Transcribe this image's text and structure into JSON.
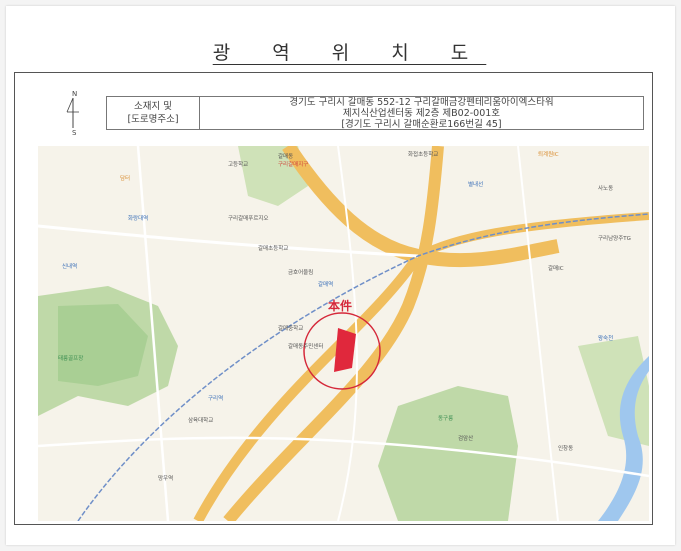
{
  "title": "광 역 위 치 도",
  "compass": {
    "north": "N",
    "south": "S"
  },
  "info": {
    "label_line1": "소재지 및",
    "label_line2": "[도로명주소]",
    "address_line1": "경기도 구리시 갈매동 552-12 구리갈매금강펜테리움아이엑스타워",
    "address_line2": "제지식산업센터동 제2층 제B02-001호",
    "address_line3": "[경기도 구리시 갈매순환로166번길 45]"
  },
  "map": {
    "subject_label": "本件",
    "colors": {
      "background": "#f6f3ea",
      "green_area": "#bfd9a8",
      "green_dark": "#8fc08c",
      "road_major": "#f0be5e",
      "road_minor": "#ffffff",
      "river": "#9fc7ee",
      "subject": "#e0283c",
      "railway": "#6f8fc8"
    },
    "labels": [
      {
        "text": "갈매동",
        "c": "",
        "l": 240,
        "t": 8
      },
      {
        "text": "구리갈매지구",
        "c": "red",
        "l": 240,
        "t": 16
      },
      {
        "text": "갈매역",
        "c": "blue",
        "l": 280,
        "t": 136
      },
      {
        "text": "고등학교",
        "c": "",
        "l": 190,
        "t": 16
      },
      {
        "text": "별내선",
        "c": "blue",
        "l": 430,
        "t": 36
      },
      {
        "text": "화접초등학교",
        "c": "",
        "l": 370,
        "t": 6
      },
      {
        "text": "갈매초등학교",
        "c": "",
        "l": 220,
        "t": 100
      },
      {
        "text": "금호어울림",
        "c": "",
        "l": 250,
        "t": 124
      },
      {
        "text": "갈매중학교",
        "c": "",
        "l": 240,
        "t": 180
      },
      {
        "text": "갈매동주민센터",
        "c": "",
        "l": 250,
        "t": 198
      },
      {
        "text": "구리갈매푸르지오",
        "c": "",
        "l": 190,
        "t": 70
      },
      {
        "text": "태릉골프장",
        "c": "green",
        "l": 20,
        "t": 210
      },
      {
        "text": "신내역",
        "c": "blue",
        "l": 24,
        "t": 118
      },
      {
        "text": "검암산",
        "c": "",
        "l": 420,
        "t": 290
      },
      {
        "text": "동구릉",
        "c": "green",
        "l": 400,
        "t": 270
      },
      {
        "text": "사노동",
        "c": "",
        "l": 560,
        "t": 40
      },
      {
        "text": "왕숙천",
        "c": "blue",
        "l": 560,
        "t": 190
      },
      {
        "text": "인창동",
        "c": "",
        "l": 520,
        "t": 300
      },
      {
        "text": "담터",
        "c": "orange",
        "l": 82,
        "t": 30
      },
      {
        "text": "화랑대역",
        "c": "blue",
        "l": 90,
        "t": 70
      },
      {
        "text": "망우역",
        "c": "",
        "l": 120,
        "t": 330
      },
      {
        "text": "구리역",
        "c": "blue",
        "l": 170,
        "t": 250
      },
      {
        "text": "삼육대학교",
        "c": "",
        "l": 150,
        "t": 272
      },
      {
        "text": "퇴계원IC",
        "c": "orange",
        "l": 500,
        "t": 6
      },
      {
        "text": "갈매IC",
        "c": "",
        "l": 510,
        "t": 120
      },
      {
        "text": "구리남양주TG",
        "c": "",
        "l": 560,
        "t": 90
      }
    ]
  }
}
